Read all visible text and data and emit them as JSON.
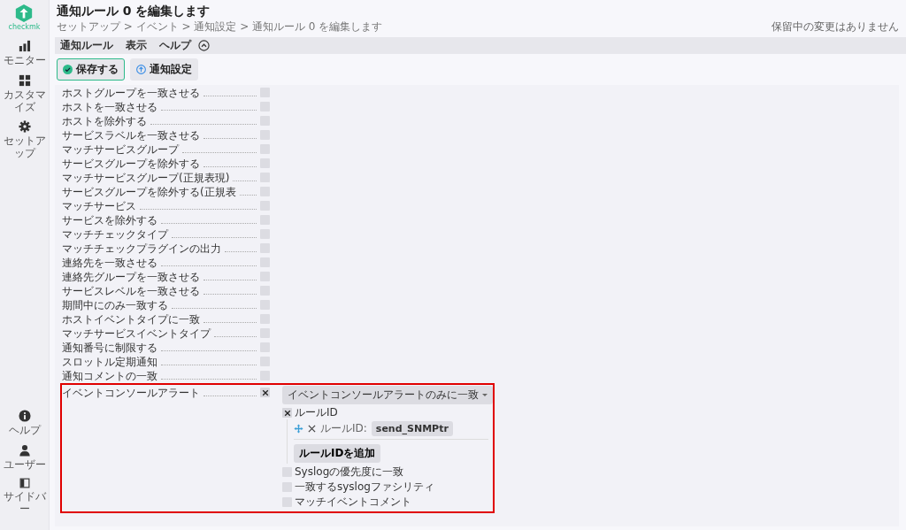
{
  "sidebar": {
    "logo": "checkmk",
    "top_items": [
      {
        "label": "モニター"
      },
      {
        "label": "カスタマイズ"
      },
      {
        "label": "セットアップ"
      }
    ],
    "bottom_items": [
      {
        "label": "ヘルプ"
      },
      {
        "label": "ユーザー"
      },
      {
        "label": "サイドバー"
      }
    ]
  },
  "header": {
    "title": "通知ルール 0 を編集します",
    "breadcrumb": "セットアップ > イベント > 通知設定 > 通知ルール 0 を編集します",
    "pending": "保留中の変更はありません"
  },
  "menu": [
    "通知ルール",
    "表示",
    "ヘルプ"
  ],
  "actions": [
    {
      "label": "保存する",
      "kind": "save"
    },
    {
      "label": "通知設定",
      "kind": "nav"
    }
  ],
  "conditions": [
    {
      "label": "ホストグループを一致させる",
      "checked": false
    },
    {
      "label": "ホストを一致させる",
      "checked": false
    },
    {
      "label": "ホストを除外する",
      "checked": false
    },
    {
      "label": "サービスラベルを一致させる",
      "checked": false
    },
    {
      "label": "マッチサービスグループ",
      "checked": false
    },
    {
      "label": "サービスグループを除外する",
      "checked": false
    },
    {
      "label": "マッチサービスグループ(正規表現)",
      "checked": false
    },
    {
      "label": "サービスグループを除外する(正規表",
      "checked": false
    },
    {
      "label": "マッチサービス",
      "checked": false
    },
    {
      "label": "サービスを除外する",
      "checked": false
    },
    {
      "label": "マッチチェックタイプ",
      "checked": false
    },
    {
      "label": "マッチチェックプラグインの出力",
      "checked": false
    },
    {
      "label": "連絡先を一致させる",
      "checked": false
    },
    {
      "label": "連絡先グループを一致させる",
      "checked": false
    },
    {
      "label": "サービスレベルを一致させる",
      "checked": false
    },
    {
      "label": "期間中にのみ一致する",
      "checked": false
    },
    {
      "label": "ホストイベントタイプに一致",
      "checked": false
    },
    {
      "label": "マッチサービスイベントタイプ",
      "checked": false
    },
    {
      "label": "通知番号に制限する",
      "checked": false
    },
    {
      "label": "スロットル定期通知",
      "checked": false
    },
    {
      "label": "通知コメントの一致",
      "checked": false
    },
    {
      "label": "イベントコンソールアラート",
      "checked": true,
      "highlighted": true,
      "detail": {
        "dropdown": "イベントコンソールアラートのみに一致",
        "options": [
          {
            "label": "ルールID",
            "checked": true,
            "entries": [
              {
                "label": "ルールID:",
                "value": "send_SNMPtr"
              }
            ],
            "add_button": "ルールIDを追加"
          },
          {
            "label": "Syslogの優先度に一致",
            "checked": false
          },
          {
            "label": "一致するsyslogファシリティ",
            "checked": false
          },
          {
            "label": "マッチイベントコメント",
            "checked": false
          }
        ]
      }
    }
  ]
}
